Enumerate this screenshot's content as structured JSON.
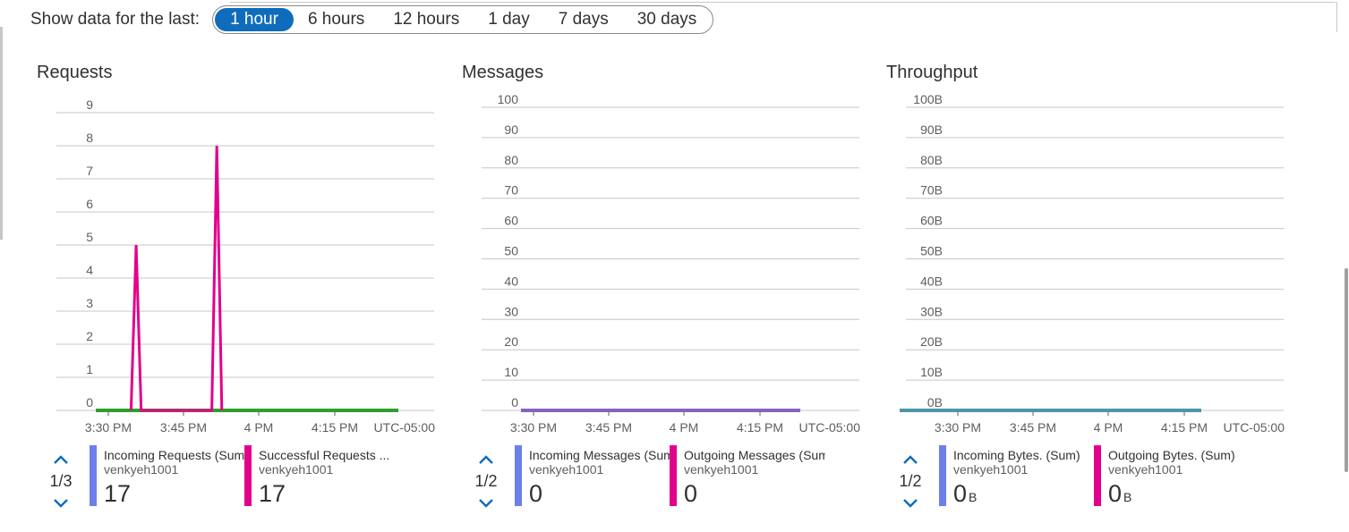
{
  "timerange": {
    "label": "Show data for the last:",
    "options": [
      "1 hour",
      "6 hours",
      "12 hours",
      "1 day",
      "7 days",
      "30 days"
    ],
    "selected": "1 hour"
  },
  "colors": {
    "accent": "#0f6cbd",
    "incoming": "#6c7fea",
    "outgoing": "#e3008c",
    "requests_line_green": "#2e9e2e",
    "requests_line_pink": "#e3008c",
    "messages_line": "#8764b8",
    "throughput_line": "#4a96a9"
  },
  "panels": [
    {
      "title": "Requests",
      "pager": "1/3",
      "legend": [
        {
          "name": "Incoming Requests (Sum)",
          "resource": "venkyeh1001",
          "value": "17",
          "unit": "",
          "color": "#6c7fea"
        },
        {
          "name": "Successful Requests ...",
          "resource": "venkyeh1001",
          "value": "17",
          "unit": "",
          "color": "#e3008c"
        }
      ]
    },
    {
      "title": "Messages",
      "pager": "1/2",
      "legend": [
        {
          "name": "Incoming Messages (Sum)",
          "resource": "venkyeh1001",
          "value": "0",
          "unit": "",
          "color": "#6c7fea"
        },
        {
          "name": "Outgoing Messages (Sum)",
          "resource": "venkyeh1001",
          "value": "0",
          "unit": "",
          "color": "#e3008c"
        }
      ]
    },
    {
      "title": "Throughput",
      "pager": "1/2",
      "legend": [
        {
          "name": "Incoming Bytes. (Sum)",
          "resource": "venkyeh1001",
          "value": "0",
          "unit": "B",
          "color": "#6c7fea"
        },
        {
          "name": "Outgoing Bytes. (Sum)",
          "resource": "venkyeh1001",
          "value": "0",
          "unit": "B",
          "color": "#e3008c"
        }
      ]
    }
  ],
  "chart_data": [
    {
      "type": "line",
      "title": "Requests",
      "ylim": [
        0,
        9
      ],
      "y_ticks": [
        "0",
        "1",
        "2",
        "3",
        "4",
        "5",
        "6",
        "7",
        "8",
        "9"
      ],
      "x_ticks": [
        "3:30 PM",
        "3:45 PM",
        "4 PM",
        "4:15 PM"
      ],
      "x_timezone": "UTC-05:00",
      "grid": true,
      "series": [
        {
          "name": "Incoming Requests (Sum)",
          "color": "#2e9e2e",
          "x": [
            0,
            60
          ],
          "y": [
            0,
            0
          ]
        },
        {
          "name": "Successful Requests (Sum)",
          "color": "#e3008c",
          "x": [
            7,
            8,
            9,
            23,
            24,
            25
          ],
          "y": [
            0,
            5,
            0,
            0,
            8,
            0
          ]
        }
      ]
    },
    {
      "type": "line",
      "title": "Messages",
      "ylim": [
        0,
        100
      ],
      "y_ticks": [
        "0",
        "10",
        "20",
        "30",
        "40",
        "50",
        "60",
        "70",
        "80",
        "90",
        "100"
      ],
      "x_ticks": [
        "3:30 PM",
        "3:45 PM",
        "4 PM",
        "4:15 PM"
      ],
      "x_timezone": "UTC-05:00",
      "grid": true,
      "series": [
        {
          "name": "Incoming Messages (Sum)",
          "color": "#8764b8",
          "x": [
            0,
            60
          ],
          "y": [
            0,
            0
          ]
        }
      ]
    },
    {
      "type": "line",
      "title": "Throughput",
      "ylim": [
        0,
        100
      ],
      "y_ticks": [
        "0B",
        "10B",
        "20B",
        "30B",
        "40B",
        "50B",
        "60B",
        "70B",
        "80B",
        "90B",
        "100B"
      ],
      "x_ticks": [
        "3:30 PM",
        "3:45 PM",
        "4 PM",
        "4:15 PM"
      ],
      "x_timezone": "UTC-05:00",
      "grid": true,
      "series": [
        {
          "name": "Incoming Bytes. (Sum)",
          "color": "#4a96a9",
          "x": [
            0,
            60
          ],
          "y": [
            0,
            0
          ]
        }
      ]
    }
  ]
}
